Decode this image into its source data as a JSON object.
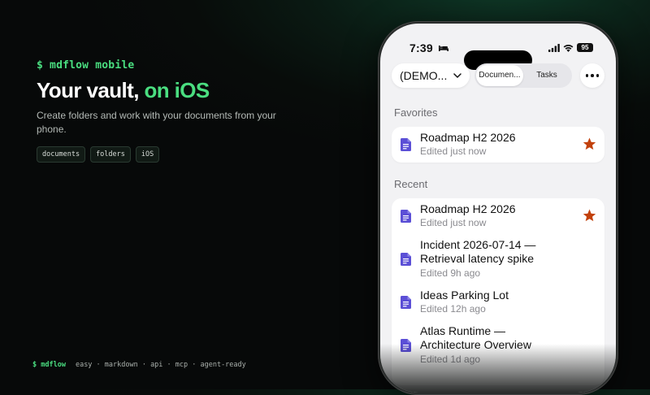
{
  "hero": {
    "prompt": "$ mdflow mobile",
    "headline_main": "Your vault, ",
    "headline_accent": "on iOS",
    "subtitle": "Create folders and work with your documents from your phone.",
    "tags": [
      "documents",
      "folders",
      "iOS"
    ]
  },
  "footer": {
    "brand": "$ mdflow",
    "features": "easy · markdown · api · mcp · agent-ready"
  },
  "phone": {
    "status": {
      "time": "7:39",
      "battery": "95"
    },
    "vault_selector": "(DEMO...",
    "segments": [
      "Documen...",
      "Tasks"
    ],
    "favorites_label": "Favorites",
    "recent_label": "Recent",
    "favorites": [
      {
        "title": "Roadmap H2 2026",
        "subtitle": "Edited just now",
        "starred": true
      }
    ],
    "recent": [
      {
        "title": "Roadmap H2 2026",
        "subtitle": "Edited just now",
        "starred": true
      },
      {
        "title": "Incident 2026-07-14 — Retrieval latency spike",
        "subtitle": "Edited 9h ago",
        "starred": false
      },
      {
        "title": "Ideas Parking Lot",
        "subtitle": "Edited 12h ago",
        "starred": false
      },
      {
        "title": "Atlas Runtime — Architecture Overview",
        "subtitle": "Edited 1d ago",
        "starred": false
      }
    ]
  },
  "colors": {
    "accent": "#4ade80",
    "doc_icon": "#5b4fd6",
    "star": "#c2410c"
  }
}
